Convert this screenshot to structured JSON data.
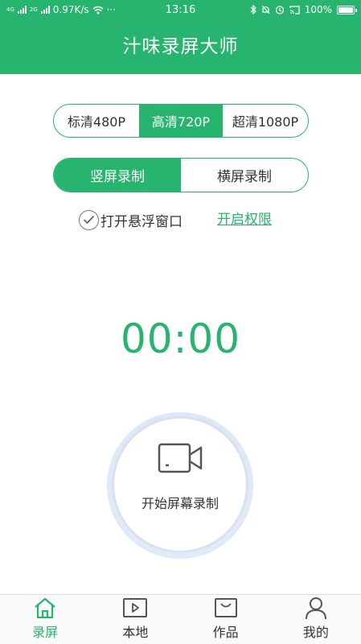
{
  "status_bar": {
    "net_labels": [
      "4G",
      "2G"
    ],
    "speed": "0.97K/s",
    "more": "···",
    "time": "13:16",
    "battery": "100%"
  },
  "header": {
    "title": "汁味录屏大师"
  },
  "quality": {
    "options": [
      "标清480P",
      "高清720P",
      "超清1080P"
    ],
    "selected": "高清720P"
  },
  "orientation": {
    "options": [
      "竖屏录制",
      "横屏录制"
    ],
    "selected": "竖屏录制"
  },
  "floating_window": {
    "label": "打开悬浮窗口",
    "checked": true
  },
  "permission": {
    "link": "开启权限"
  },
  "timer": {
    "display": "00:00"
  },
  "record": {
    "label": "开始屏幕录制"
  },
  "tabs": [
    {
      "label": "录屏",
      "icon": "home-icon",
      "active": true
    },
    {
      "label": "本地",
      "icon": "play-box-icon",
      "active": false
    },
    {
      "label": "作品",
      "icon": "works-box-icon",
      "active": false
    },
    {
      "label": "我的",
      "icon": "user-icon",
      "active": false
    }
  ],
  "colors": {
    "accent": "#27b46e",
    "text": "#333333"
  }
}
